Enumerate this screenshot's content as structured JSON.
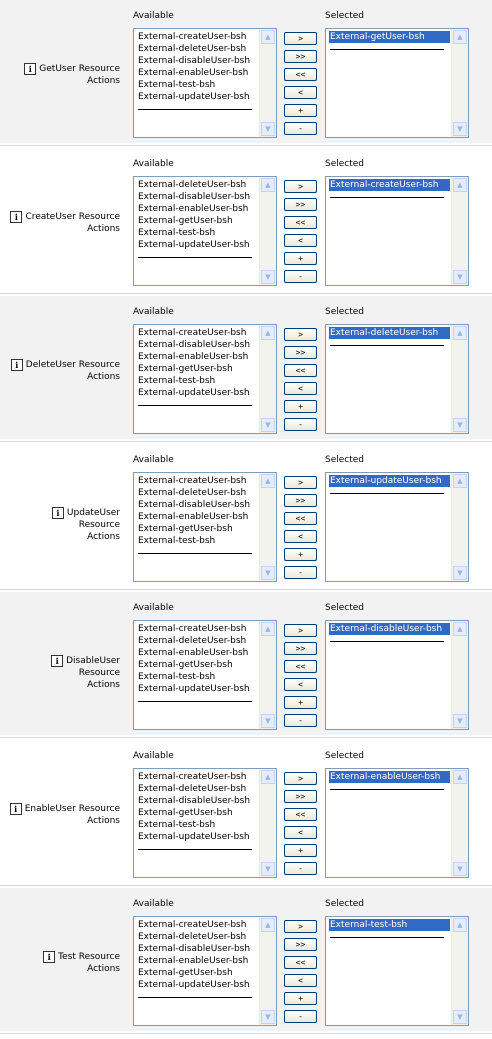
{
  "column_titles": {
    "available": "Available",
    "selected": "Selected"
  },
  "buttons": {
    "add": ">",
    "add_all": ">>",
    "remove_all": "<<",
    "remove": "<",
    "move_up": "+",
    "move_down": "-"
  },
  "info_icon_text": "i",
  "sections": [
    {
      "label_line1": "GetUser Resource",
      "label_line2": "Actions",
      "available": [
        "External-createUser-bsh",
        "External-deleteUser-bsh",
        "External-disableUser-bsh",
        "External-enableUser-bsh",
        "External-test-bsh",
        "External-updateUser-bsh"
      ],
      "selected": [
        "External-getUser-bsh"
      ]
    },
    {
      "label_line1": "CreateUser Resource",
      "label_line2": "Actions",
      "available": [
        "External-deleteUser-bsh",
        "External-disableUser-bsh",
        "External-enableUser-bsh",
        "External-getUser-bsh",
        "External-test-bsh",
        "External-updateUser-bsh"
      ],
      "selected": [
        "External-createUser-bsh"
      ]
    },
    {
      "label_line1": "DeleteUser Resource",
      "label_line2": "Actions",
      "available": [
        "External-createUser-bsh",
        "External-disableUser-bsh",
        "External-enableUser-bsh",
        "External-getUser-bsh",
        "External-test-bsh",
        "External-updateUser-bsh"
      ],
      "selected": [
        "External-deleteUser-bsh"
      ]
    },
    {
      "label_line1": "UpdateUser Resource",
      "label_line2": "Actions",
      "available": [
        "External-createUser-bsh",
        "External-deleteUser-bsh",
        "External-disableUser-bsh",
        "External-enableUser-bsh",
        "External-getUser-bsh",
        "External-test-bsh"
      ],
      "selected": [
        "External-updateUser-bsh"
      ]
    },
    {
      "label_line1": "DisableUser Resource",
      "label_line2": "Actions",
      "available": [
        "External-createUser-bsh",
        "External-deleteUser-bsh",
        "External-enableUser-bsh",
        "External-getUser-bsh",
        "External-test-bsh",
        "External-updateUser-bsh"
      ],
      "selected": [
        "External-disableUser-bsh"
      ]
    },
    {
      "label_line1": "EnableUser Resource",
      "label_line2": "Actions",
      "available": [
        "External-createUser-bsh",
        "External-deleteUser-bsh",
        "External-disableUser-bsh",
        "External-getUser-bsh",
        "External-test-bsh",
        "External-updateUser-bsh"
      ],
      "selected": [
        "External-enableUser-bsh"
      ]
    },
    {
      "label_line1": "Test Resource Actions",
      "label_line2": "",
      "available": [
        "External-createUser-bsh",
        "External-deleteUser-bsh",
        "External-disableUser-bsh",
        "External-enableUser-bsh",
        "External-getUser-bsh",
        "External-updateUser-bsh"
      ],
      "selected": [
        "External-test-bsh"
      ]
    }
  ]
}
